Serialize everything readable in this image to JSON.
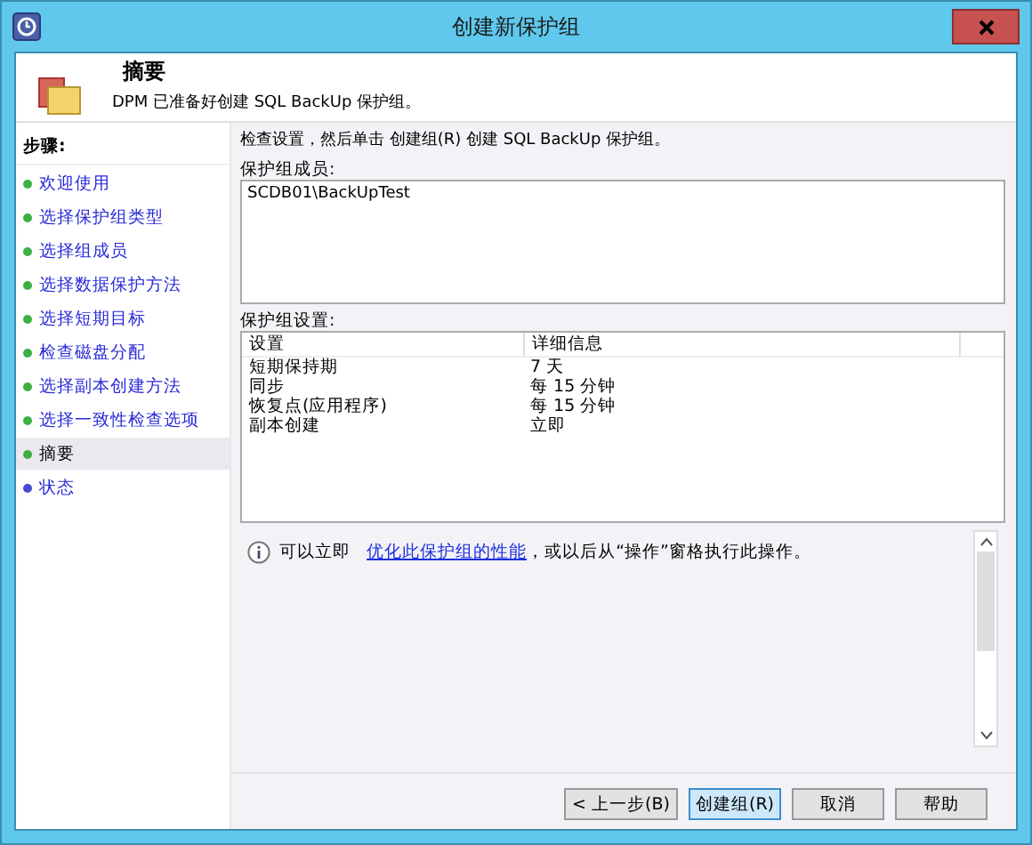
{
  "window": {
    "title": "创建新保护组"
  },
  "header": {
    "title": "摘要",
    "subtitle": "DPM 已准备好创建 SQL BackUp 保护组。"
  },
  "sidebar": {
    "title": "步骤:",
    "items": [
      {
        "label": "欢迎使用",
        "selected": false,
        "color": "#3cb043"
      },
      {
        "label": "选择保护组类型",
        "selected": false,
        "color": "#3cb043"
      },
      {
        "label": "选择组成员",
        "selected": false,
        "color": "#3cb043"
      },
      {
        "label": "选择数据保护方法",
        "selected": false,
        "color": "#3cb043"
      },
      {
        "label": "选择短期目标",
        "selected": false,
        "color": "#3cb043"
      },
      {
        "label": "检查磁盘分配",
        "selected": false,
        "color": "#3cb043"
      },
      {
        "label": "选择副本创建方法",
        "selected": false,
        "color": "#3cb043"
      },
      {
        "label": "选择一致性检查选项",
        "selected": false,
        "color": "#3cb043"
      },
      {
        "label": "摘要",
        "selected": true,
        "color": "#3cb043"
      },
      {
        "label": "状态",
        "selected": false,
        "color": "#4a4ad0"
      }
    ]
  },
  "instruction": "检查设置，然后单击 创建组(R) 创建 SQL BackUp 保护组。",
  "members": {
    "label": "保护组成员:",
    "value": "SCDB01\\BackUpTest"
  },
  "settings": {
    "label": "保护组设置:",
    "columns": [
      "设置",
      "详细信息"
    ],
    "rows": [
      [
        "短期保持期",
        "7 天"
      ],
      [
        "同步",
        "每 15 分钟"
      ],
      [
        "恢复点(应用程序)",
        "每 15 分钟"
      ],
      [
        "副本创建",
        "立即"
      ]
    ]
  },
  "info": {
    "before": "可以立即",
    "link": "优化此保护组的性能",
    "after": "，或以后从“操作”窗格执行此操作。"
  },
  "buttons": [
    {
      "label": "< 上一步(B)",
      "default": false
    },
    {
      "label": "创建组(R)",
      "default": true
    },
    {
      "label": "取消",
      "default": false
    },
    {
      "label": "帮助",
      "default": false
    }
  ]
}
